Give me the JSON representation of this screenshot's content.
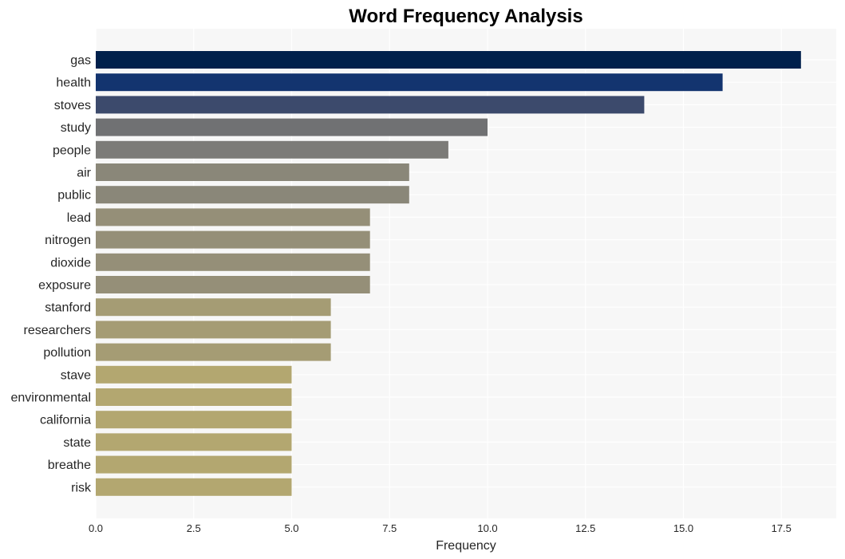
{
  "chart_data": {
    "type": "bar",
    "orientation": "horizontal",
    "title": "Word Frequency Analysis",
    "xlabel": "Frequency",
    "ylabel": "",
    "xlim": [
      0,
      18.9
    ],
    "xticks": [
      0.0,
      2.5,
      5.0,
      7.5,
      10.0,
      12.5,
      15.0,
      17.5
    ],
    "xtick_labels": [
      "0.0",
      "2.5",
      "5.0",
      "7.5",
      "10.0",
      "12.5",
      "15.0",
      "17.5"
    ],
    "grid": true,
    "legend": "none",
    "categories": [
      "gas",
      "health",
      "stoves",
      "study",
      "people",
      "air",
      "public",
      "lead",
      "nitrogen",
      "dioxide",
      "exposure",
      "stanford",
      "researchers",
      "pollution",
      "stave",
      "environmental",
      "california",
      "state",
      "breathe",
      "risk"
    ],
    "values": [
      18,
      16,
      14,
      10,
      9,
      8,
      8,
      7,
      7,
      7,
      7,
      6,
      6,
      6,
      5,
      5,
      5,
      5,
      5,
      5
    ],
    "colors": [
      "#00204c",
      "#13346f",
      "#3c4a6c",
      "#707173",
      "#7c7b78",
      "#8a8779",
      "#8a8779",
      "#958f78",
      "#958f78",
      "#958f78",
      "#958f78",
      "#a59c74",
      "#a59c74",
      "#a59c74",
      "#b3a770",
      "#b3a770",
      "#b3a770",
      "#b3a770",
      "#b3a770",
      "#b3a770"
    ],
    "plot_background": "#f7f7f7",
    "grid_color": "#ffffff"
  }
}
